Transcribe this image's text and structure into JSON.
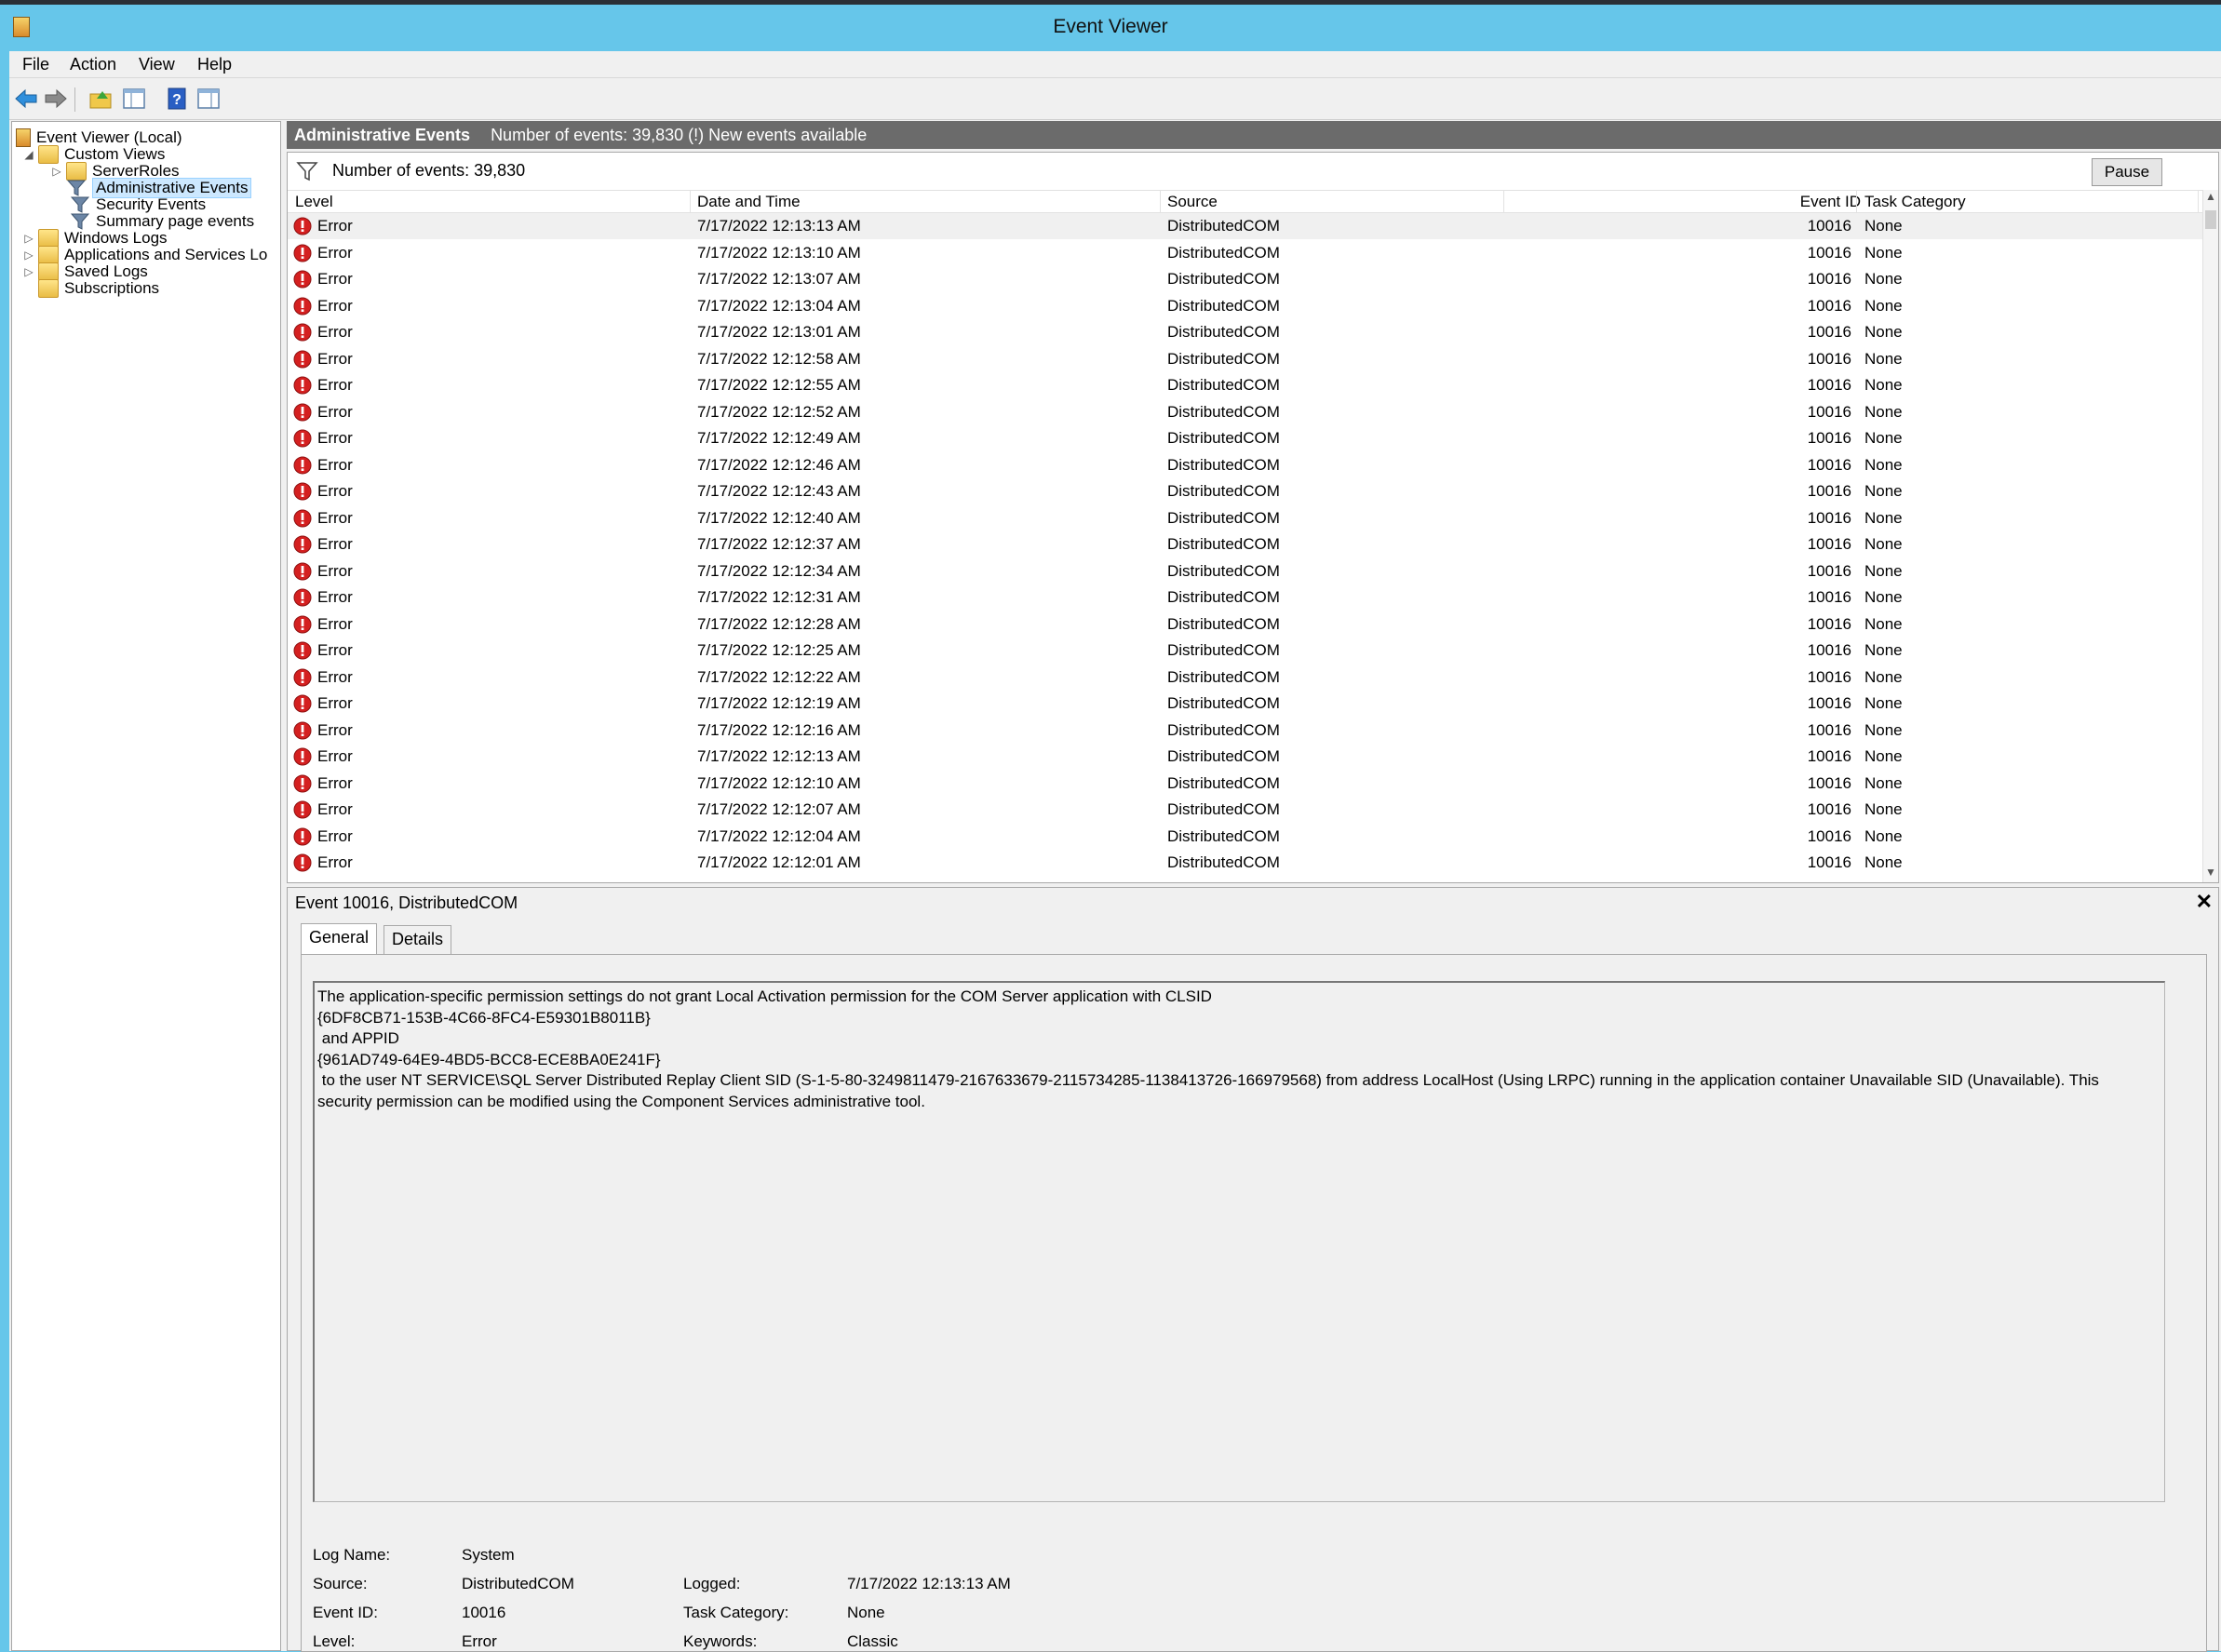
{
  "window": {
    "title": "Event Viewer"
  },
  "menu": [
    "File",
    "Action",
    "View",
    "Help"
  ],
  "toolbar": {
    "buttons": [
      "back-icon",
      "forward-icon",
      "up-folder-icon",
      "show-hide-tree-icon",
      "help-icon",
      "show-hide-action-pane-icon"
    ]
  },
  "tree": {
    "root": "Event Viewer (Local)",
    "custom_views": "Custom Views",
    "server_roles": "ServerRoles",
    "administrative_events": "Administrative Events",
    "security_events": "Security Events",
    "summary_page_events": "Summary page events",
    "windows_logs": "Windows Logs",
    "apps_services": "Applications and Services Lo",
    "saved_logs": "Saved Logs",
    "subscriptions": "Subscriptions"
  },
  "header": {
    "title": "Administrative Events",
    "info": "Number of events: 39,830 (!) New events available"
  },
  "filter": {
    "text": "Number of events: 39,830",
    "pause_label": "Pause"
  },
  "columns": {
    "level": "Level",
    "date": "Date and Time",
    "source": "Source",
    "event_id": "Event ID",
    "task": "Task Category"
  },
  "events": [
    {
      "level": "Error",
      "date": "7/17/2022 12:13:13 AM",
      "source": "DistributedCOM",
      "event_id": "10016",
      "task": "None"
    },
    {
      "level": "Error",
      "date": "7/17/2022 12:13:10 AM",
      "source": "DistributedCOM",
      "event_id": "10016",
      "task": "None"
    },
    {
      "level": "Error",
      "date": "7/17/2022 12:13:07 AM",
      "source": "DistributedCOM",
      "event_id": "10016",
      "task": "None"
    },
    {
      "level": "Error",
      "date": "7/17/2022 12:13:04 AM",
      "source": "DistributedCOM",
      "event_id": "10016",
      "task": "None"
    },
    {
      "level": "Error",
      "date": "7/17/2022 12:13:01 AM",
      "source": "DistributedCOM",
      "event_id": "10016",
      "task": "None"
    },
    {
      "level": "Error",
      "date": "7/17/2022 12:12:58 AM",
      "source": "DistributedCOM",
      "event_id": "10016",
      "task": "None"
    },
    {
      "level": "Error",
      "date": "7/17/2022 12:12:55 AM",
      "source": "DistributedCOM",
      "event_id": "10016",
      "task": "None"
    },
    {
      "level": "Error",
      "date": "7/17/2022 12:12:52 AM",
      "source": "DistributedCOM",
      "event_id": "10016",
      "task": "None"
    },
    {
      "level": "Error",
      "date": "7/17/2022 12:12:49 AM",
      "source": "DistributedCOM",
      "event_id": "10016",
      "task": "None"
    },
    {
      "level": "Error",
      "date": "7/17/2022 12:12:46 AM",
      "source": "DistributedCOM",
      "event_id": "10016",
      "task": "None"
    },
    {
      "level": "Error",
      "date": "7/17/2022 12:12:43 AM",
      "source": "DistributedCOM",
      "event_id": "10016",
      "task": "None"
    },
    {
      "level": "Error",
      "date": "7/17/2022 12:12:40 AM",
      "source": "DistributedCOM",
      "event_id": "10016",
      "task": "None"
    },
    {
      "level": "Error",
      "date": "7/17/2022 12:12:37 AM",
      "source": "DistributedCOM",
      "event_id": "10016",
      "task": "None"
    },
    {
      "level": "Error",
      "date": "7/17/2022 12:12:34 AM",
      "source": "DistributedCOM",
      "event_id": "10016",
      "task": "None"
    },
    {
      "level": "Error",
      "date": "7/17/2022 12:12:31 AM",
      "source": "DistributedCOM",
      "event_id": "10016",
      "task": "None"
    },
    {
      "level": "Error",
      "date": "7/17/2022 12:12:28 AM",
      "source": "DistributedCOM",
      "event_id": "10016",
      "task": "None"
    },
    {
      "level": "Error",
      "date": "7/17/2022 12:12:25 AM",
      "source": "DistributedCOM",
      "event_id": "10016",
      "task": "None"
    },
    {
      "level": "Error",
      "date": "7/17/2022 12:12:22 AM",
      "source": "DistributedCOM",
      "event_id": "10016",
      "task": "None"
    },
    {
      "level": "Error",
      "date": "7/17/2022 12:12:19 AM",
      "source": "DistributedCOM",
      "event_id": "10016",
      "task": "None"
    },
    {
      "level": "Error",
      "date": "7/17/2022 12:12:16 AM",
      "source": "DistributedCOM",
      "event_id": "10016",
      "task": "None"
    },
    {
      "level": "Error",
      "date": "7/17/2022 12:12:13 AM",
      "source": "DistributedCOM",
      "event_id": "10016",
      "task": "None"
    },
    {
      "level": "Error",
      "date": "7/17/2022 12:12:10 AM",
      "source": "DistributedCOM",
      "event_id": "10016",
      "task": "None"
    },
    {
      "level": "Error",
      "date": "7/17/2022 12:12:07 AM",
      "source": "DistributedCOM",
      "event_id": "10016",
      "task": "None"
    },
    {
      "level": "Error",
      "date": "7/17/2022 12:12:04 AM",
      "source": "DistributedCOM",
      "event_id": "10016",
      "task": "None"
    },
    {
      "level": "Error",
      "date": "7/17/2022 12:12:01 AM",
      "source": "DistributedCOM",
      "event_id": "10016",
      "task": "None"
    }
  ],
  "detail": {
    "title": "Event 10016, DistributedCOM",
    "tabs": {
      "general": "General",
      "details": "Details"
    },
    "description_lines": [
      "The application-specific permission settings do not grant Local Activation permission for the COM Server application with CLSID",
      "{6DF8CB71-153B-4C66-8FC4-E59301B8011B}",
      " and APPID",
      "{961AD749-64E9-4BD5-BCC8-ECE8BA0E241F}",
      " to the user NT SERVICE\\SQL Server Distributed Replay Client SID (S-1-5-80-3249811479-2167633679-2115734285-1138413726-166979568) from address LocalHost (Using LRPC) running in the application container Unavailable SID (Unavailable). This",
      "security permission can be modified using the Component Services administrative tool."
    ],
    "props": {
      "log_name_label": "Log Name:",
      "log_name": "System",
      "source_label": "Source:",
      "source": "DistributedCOM",
      "logged_label": "Logged:",
      "logged": "7/17/2022 12:13:13 AM",
      "event_id_label": "Event ID:",
      "event_id": "10016",
      "task_label": "Task Category:",
      "task": "None",
      "level_label": "Level:",
      "level": "Error",
      "keywords_label": "Keywords:",
      "keywords": "Classic"
    }
  },
  "colors": {
    "titlebar": "#66c6ea",
    "header_strip": "#6b6b6b",
    "error_red": "#d42020",
    "selection": "#cce8ff"
  }
}
